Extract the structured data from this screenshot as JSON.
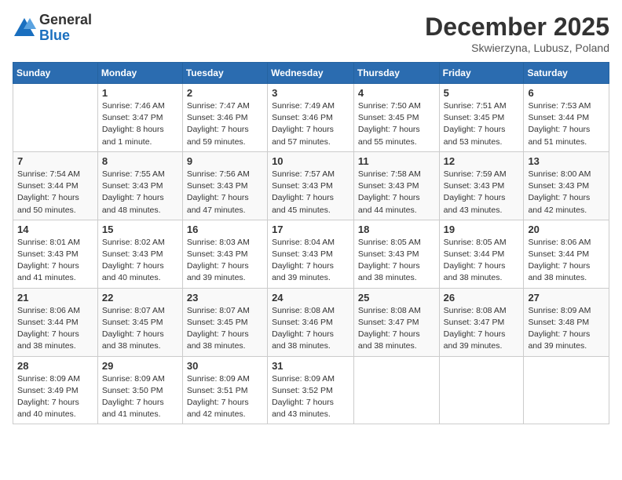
{
  "header": {
    "logo_general": "General",
    "logo_blue": "Blue",
    "month_title": "December 2025",
    "subtitle": "Skwierzyna, Lubusz, Poland"
  },
  "days_of_week": [
    "Sunday",
    "Monday",
    "Tuesday",
    "Wednesday",
    "Thursday",
    "Friday",
    "Saturday"
  ],
  "weeks": [
    [
      {
        "day": "",
        "sunrise": "",
        "sunset": "",
        "daylight": ""
      },
      {
        "day": "1",
        "sunrise": "Sunrise: 7:46 AM",
        "sunset": "Sunset: 3:47 PM",
        "daylight": "Daylight: 8 hours and 1 minute."
      },
      {
        "day": "2",
        "sunrise": "Sunrise: 7:47 AM",
        "sunset": "Sunset: 3:46 PM",
        "daylight": "Daylight: 7 hours and 59 minutes."
      },
      {
        "day": "3",
        "sunrise": "Sunrise: 7:49 AM",
        "sunset": "Sunset: 3:46 PM",
        "daylight": "Daylight: 7 hours and 57 minutes."
      },
      {
        "day": "4",
        "sunrise": "Sunrise: 7:50 AM",
        "sunset": "Sunset: 3:45 PM",
        "daylight": "Daylight: 7 hours and 55 minutes."
      },
      {
        "day": "5",
        "sunrise": "Sunrise: 7:51 AM",
        "sunset": "Sunset: 3:45 PM",
        "daylight": "Daylight: 7 hours and 53 minutes."
      },
      {
        "day": "6",
        "sunrise": "Sunrise: 7:53 AM",
        "sunset": "Sunset: 3:44 PM",
        "daylight": "Daylight: 7 hours and 51 minutes."
      }
    ],
    [
      {
        "day": "7",
        "sunrise": "Sunrise: 7:54 AM",
        "sunset": "Sunset: 3:44 PM",
        "daylight": "Daylight: 7 hours and 50 minutes."
      },
      {
        "day": "8",
        "sunrise": "Sunrise: 7:55 AM",
        "sunset": "Sunset: 3:43 PM",
        "daylight": "Daylight: 7 hours and 48 minutes."
      },
      {
        "day": "9",
        "sunrise": "Sunrise: 7:56 AM",
        "sunset": "Sunset: 3:43 PM",
        "daylight": "Daylight: 7 hours and 47 minutes."
      },
      {
        "day": "10",
        "sunrise": "Sunrise: 7:57 AM",
        "sunset": "Sunset: 3:43 PM",
        "daylight": "Daylight: 7 hours and 45 minutes."
      },
      {
        "day": "11",
        "sunrise": "Sunrise: 7:58 AM",
        "sunset": "Sunset: 3:43 PM",
        "daylight": "Daylight: 7 hours and 44 minutes."
      },
      {
        "day": "12",
        "sunrise": "Sunrise: 7:59 AM",
        "sunset": "Sunset: 3:43 PM",
        "daylight": "Daylight: 7 hours and 43 minutes."
      },
      {
        "day": "13",
        "sunrise": "Sunrise: 8:00 AM",
        "sunset": "Sunset: 3:43 PM",
        "daylight": "Daylight: 7 hours and 42 minutes."
      }
    ],
    [
      {
        "day": "14",
        "sunrise": "Sunrise: 8:01 AM",
        "sunset": "Sunset: 3:43 PM",
        "daylight": "Daylight: 7 hours and 41 minutes."
      },
      {
        "day": "15",
        "sunrise": "Sunrise: 8:02 AM",
        "sunset": "Sunset: 3:43 PM",
        "daylight": "Daylight: 7 hours and 40 minutes."
      },
      {
        "day": "16",
        "sunrise": "Sunrise: 8:03 AM",
        "sunset": "Sunset: 3:43 PM",
        "daylight": "Daylight: 7 hours and 39 minutes."
      },
      {
        "day": "17",
        "sunrise": "Sunrise: 8:04 AM",
        "sunset": "Sunset: 3:43 PM",
        "daylight": "Daylight: 7 hours and 39 minutes."
      },
      {
        "day": "18",
        "sunrise": "Sunrise: 8:05 AM",
        "sunset": "Sunset: 3:43 PM",
        "daylight": "Daylight: 7 hours and 38 minutes."
      },
      {
        "day": "19",
        "sunrise": "Sunrise: 8:05 AM",
        "sunset": "Sunset: 3:44 PM",
        "daylight": "Daylight: 7 hours and 38 minutes."
      },
      {
        "day": "20",
        "sunrise": "Sunrise: 8:06 AM",
        "sunset": "Sunset: 3:44 PM",
        "daylight": "Daylight: 7 hours and 38 minutes."
      }
    ],
    [
      {
        "day": "21",
        "sunrise": "Sunrise: 8:06 AM",
        "sunset": "Sunset: 3:44 PM",
        "daylight": "Daylight: 7 hours and 38 minutes."
      },
      {
        "day": "22",
        "sunrise": "Sunrise: 8:07 AM",
        "sunset": "Sunset: 3:45 PM",
        "daylight": "Daylight: 7 hours and 38 minutes."
      },
      {
        "day": "23",
        "sunrise": "Sunrise: 8:07 AM",
        "sunset": "Sunset: 3:45 PM",
        "daylight": "Daylight: 7 hours and 38 minutes."
      },
      {
        "day": "24",
        "sunrise": "Sunrise: 8:08 AM",
        "sunset": "Sunset: 3:46 PM",
        "daylight": "Daylight: 7 hours and 38 minutes."
      },
      {
        "day": "25",
        "sunrise": "Sunrise: 8:08 AM",
        "sunset": "Sunset: 3:47 PM",
        "daylight": "Daylight: 7 hours and 38 minutes."
      },
      {
        "day": "26",
        "sunrise": "Sunrise: 8:08 AM",
        "sunset": "Sunset: 3:47 PM",
        "daylight": "Daylight: 7 hours and 39 minutes."
      },
      {
        "day": "27",
        "sunrise": "Sunrise: 8:09 AM",
        "sunset": "Sunset: 3:48 PM",
        "daylight": "Daylight: 7 hours and 39 minutes."
      }
    ],
    [
      {
        "day": "28",
        "sunrise": "Sunrise: 8:09 AM",
        "sunset": "Sunset: 3:49 PM",
        "daylight": "Daylight: 7 hours and 40 minutes."
      },
      {
        "day": "29",
        "sunrise": "Sunrise: 8:09 AM",
        "sunset": "Sunset: 3:50 PM",
        "daylight": "Daylight: 7 hours and 41 minutes."
      },
      {
        "day": "30",
        "sunrise": "Sunrise: 8:09 AM",
        "sunset": "Sunset: 3:51 PM",
        "daylight": "Daylight: 7 hours and 42 minutes."
      },
      {
        "day": "31",
        "sunrise": "Sunrise: 8:09 AM",
        "sunset": "Sunset: 3:52 PM",
        "daylight": "Daylight: 7 hours and 43 minutes."
      },
      {
        "day": "",
        "sunrise": "",
        "sunset": "",
        "daylight": ""
      },
      {
        "day": "",
        "sunrise": "",
        "sunset": "",
        "daylight": ""
      },
      {
        "day": "",
        "sunrise": "",
        "sunset": "",
        "daylight": ""
      }
    ]
  ]
}
